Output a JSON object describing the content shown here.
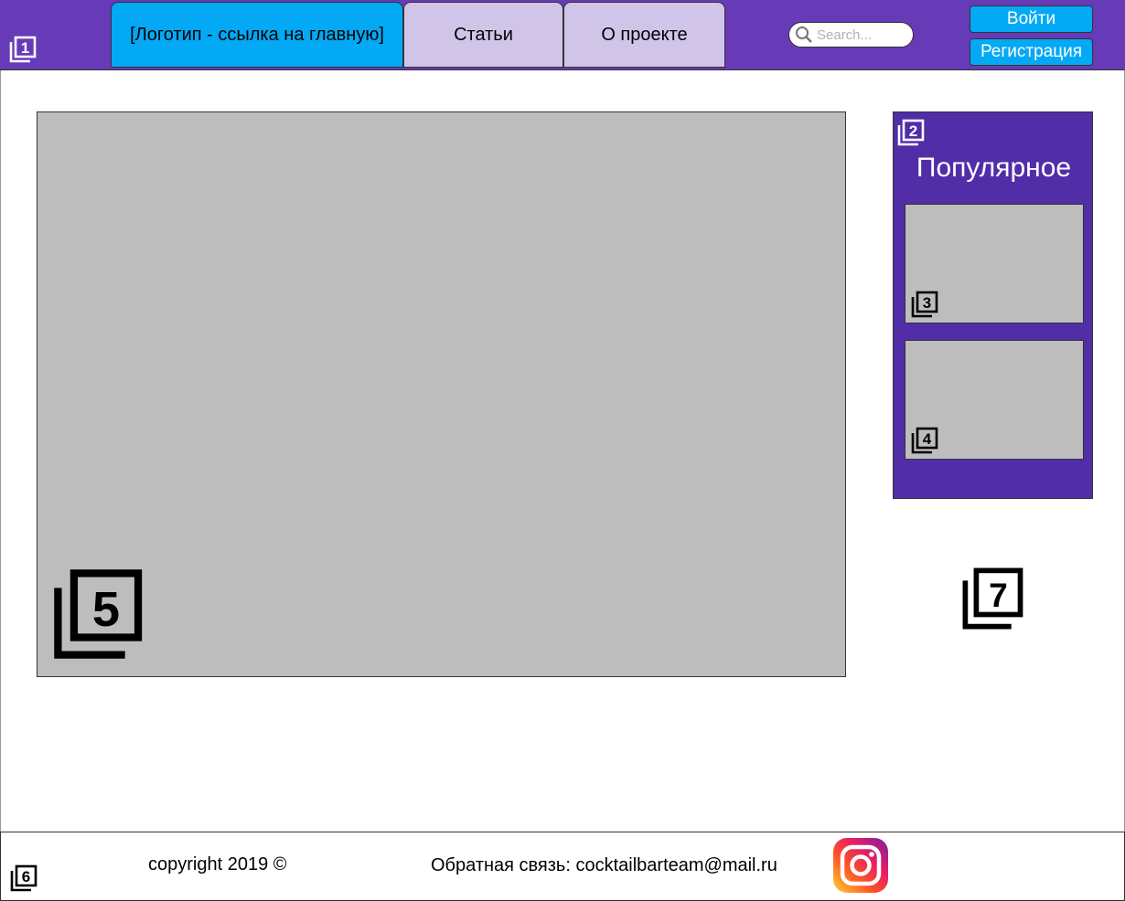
{
  "header": {
    "tabs": [
      {
        "label": "[Логотип - ссылка на главную]"
      },
      {
        "label": "Статьи"
      },
      {
        "label": "О проекте"
      }
    ],
    "search_placeholder": "Search...",
    "login_label": "Войти",
    "register_label": "Регистрация",
    "marker": "1"
  },
  "sidebar": {
    "title": "Популярное",
    "marker": "2",
    "cards": [
      {
        "marker": "3"
      },
      {
        "marker": "4"
      }
    ]
  },
  "main": {
    "image_marker": "5",
    "aside_marker": "7"
  },
  "footer": {
    "marker": "6",
    "copyright": "copyright 2019 ©",
    "feedback": "Обратная связь: cocktailbarteam@mail.ru"
  },
  "colors": {
    "header_bg": "#673ab7",
    "logo_tab": "#03a9f4",
    "tab": "#d1c4e9",
    "sidebar_bg": "#512da8",
    "placeholder_gray": "#bdbdbd"
  }
}
